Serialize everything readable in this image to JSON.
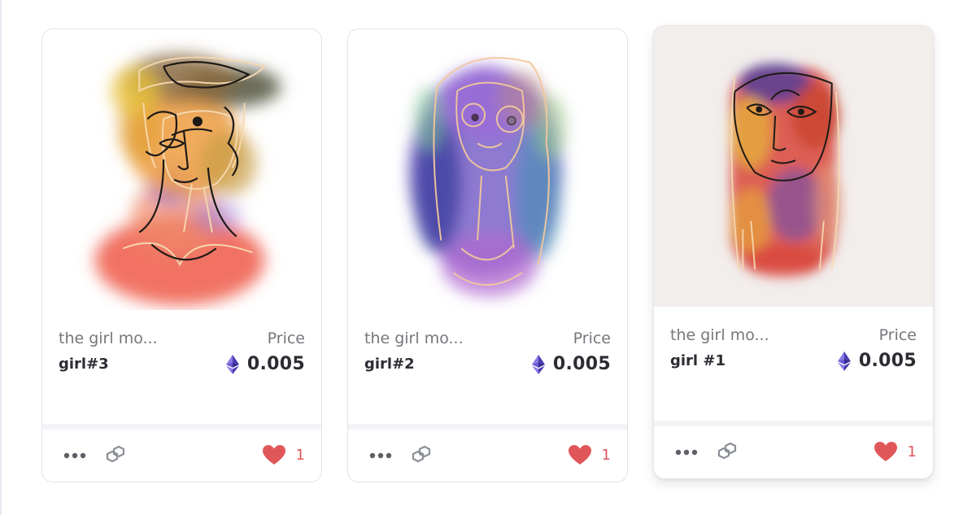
{
  "colors": {
    "heart": "#e0575a",
    "eth": "#6c5bd3",
    "text_primary": "#2c2c33",
    "text_secondary": "#75777c"
  },
  "cards": [
    {
      "collection": "the girl mo...",
      "name": "girl#3",
      "price_label": "Price",
      "price": "0.005",
      "currency_icon": "ethereum-icon",
      "likes": "1",
      "actions": [
        "more-icon",
        "link-icon",
        "heart-icon"
      ]
    },
    {
      "collection": "the girl mo...",
      "name": "girl#2",
      "price_label": "Price",
      "price": "0.005",
      "currency_icon": "ethereum-icon",
      "likes": "1",
      "actions": [
        "more-icon",
        "link-icon",
        "heart-icon"
      ]
    },
    {
      "collection": "the girl mo...",
      "name": "girl #1",
      "price_label": "Price",
      "price": "0.005",
      "currency_icon": "ethereum-icon",
      "likes": "1",
      "actions": [
        "more-icon",
        "link-icon",
        "heart-icon"
      ]
    }
  ]
}
